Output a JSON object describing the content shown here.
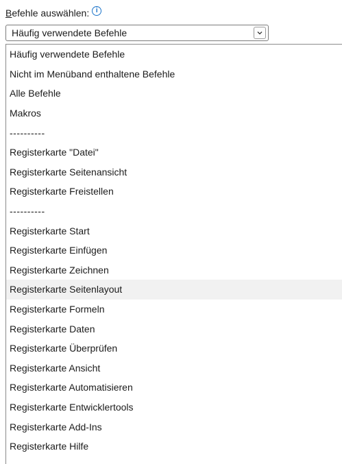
{
  "chooser": {
    "label_mnemonic": "B",
    "label_rest": "efehle auswählen:",
    "info_icon": "info-icon",
    "selected_value": "Häufig verwendete Befehle",
    "dropdown_icon": "chevron-down-icon"
  },
  "list": {
    "items": [
      {
        "label": "Häufig verwendete Befehle",
        "highlighted": false
      },
      {
        "label": "Nicht im Menüband enthaltene Befehle",
        "highlighted": false
      },
      {
        "label": "Alle Befehle",
        "highlighted": false
      },
      {
        "label": "Makros",
        "highlighted": false
      },
      {
        "label": "----------",
        "highlighted": false,
        "separator": true
      },
      {
        "label": "Registerkarte \"Datei\"",
        "highlighted": false
      },
      {
        "label": "Registerkarte Seitenansicht",
        "highlighted": false
      },
      {
        "label": "Registerkarte Freistellen",
        "highlighted": false
      },
      {
        "label": "----------",
        "highlighted": false,
        "separator": true
      },
      {
        "label": "Registerkarte Start",
        "highlighted": false
      },
      {
        "label": "Registerkarte Einfügen",
        "highlighted": false
      },
      {
        "label": "Registerkarte Zeichnen",
        "highlighted": false
      },
      {
        "label": "Registerkarte Seitenlayout",
        "highlighted": true
      },
      {
        "label": "Registerkarte Formeln",
        "highlighted": false
      },
      {
        "label": "Registerkarte Daten",
        "highlighted": false
      },
      {
        "label": "Registerkarte Überprüfen",
        "highlighted": false
      },
      {
        "label": "Registerkarte Ansicht",
        "highlighted": false
      },
      {
        "label": "Registerkarte Automatisieren",
        "highlighted": false
      },
      {
        "label": "Registerkarte Entwicklertools",
        "highlighted": false
      },
      {
        "label": "Registerkarte Add-Ins",
        "highlighted": false
      },
      {
        "label": "Registerkarte Hilfe",
        "highlighted": false
      }
    ]
  },
  "colors": {
    "info_icon": "#1a73c9",
    "highlight_row": "#f1f1f1",
    "border": "#7a7a7a"
  }
}
